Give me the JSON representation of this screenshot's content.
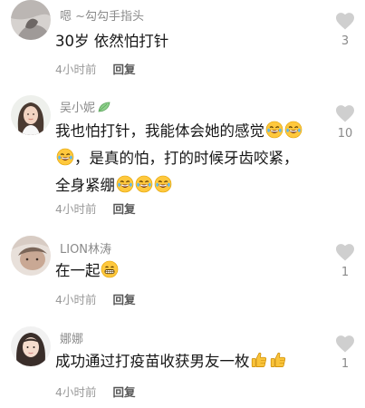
{
  "comments": [
    {
      "username": "嗯 ~勾勾手指头",
      "text": "30岁 依然怕打针",
      "time": "4小时前",
      "reply": "回复",
      "likes": "3"
    },
    {
      "username": "吴小妮",
      "badge_icon": "leaf-badge-icon",
      "text_line1": "我也怕打针，我能体会她的感觉",
      "text_line2": "，是真的怕，打的时候牙齿咬紧，",
      "text_line3": "全身紧绷",
      "time": "4小时前",
      "reply": "回复",
      "likes": "10"
    },
    {
      "username": "LION林涛",
      "text": "在一起",
      "time": "4小时前",
      "reply": "回复",
      "likes": "1"
    },
    {
      "username": "娜娜",
      "text": "成功通过打疫苗收获男友一枚",
      "time": "4小时前",
      "reply": "回复",
      "likes": "1"
    }
  ],
  "colors": {
    "username": "#8a8a8a",
    "text": "#161616",
    "meta": "#9a9a9a",
    "reply": "#555555",
    "heart": "#cfcfcf",
    "emoji": "#ffcc33"
  }
}
